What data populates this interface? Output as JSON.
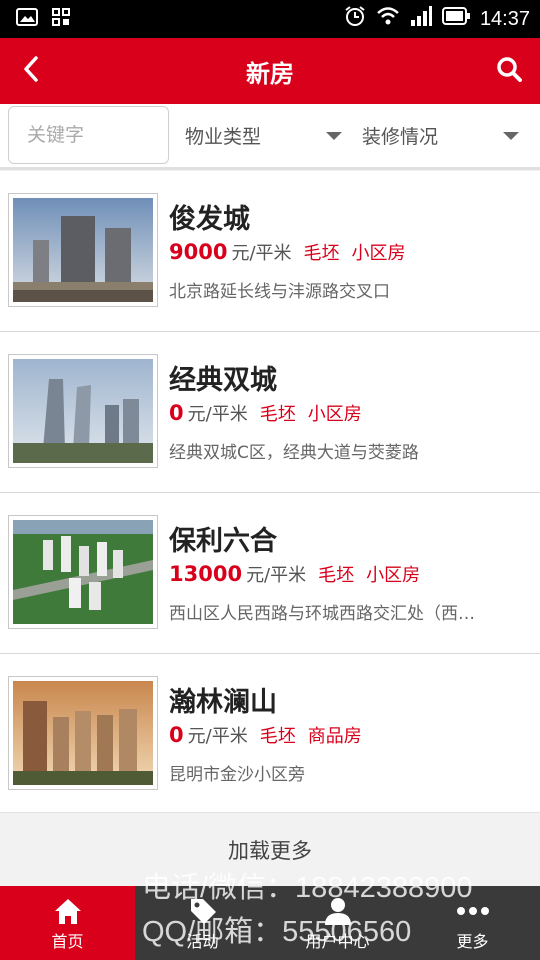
{
  "status_bar": {
    "time": "14:37",
    "icons": [
      "image-icon",
      "grid-icon",
      "alarm-icon",
      "wifi-icon",
      "signal-icon",
      "battery-icon"
    ]
  },
  "nav": {
    "title": "新房",
    "back_icon": "chevron-left-icon",
    "search_icon": "search-icon"
  },
  "filters": {
    "keyword_placeholder": "关键字",
    "property_type": "物业类型",
    "decoration": "装修情况"
  },
  "listings": [
    {
      "name": "俊发城",
      "price": "9000",
      "unit": "元/平米",
      "decoration": "毛坯",
      "type": "小区房",
      "address": "北京路延长线与沣源路交叉口"
    },
    {
      "name": "经典双城",
      "price": "0",
      "unit": "元/平米",
      "decoration": "毛坯",
      "type": "小区房",
      "address": "经典双城C区，经典大道与茭菱路"
    },
    {
      "name": "保利六合",
      "price": "13000",
      "unit": "元/平米",
      "decoration": "毛坯",
      "type": "小区房",
      "address": "西山区人民西路与环城西路交汇处（西…"
    },
    {
      "name": "瀚林澜山",
      "price": "0",
      "unit": "元/平米",
      "decoration": "毛坯",
      "type": "商品房",
      "address": "昆明市金沙小区旁"
    }
  ],
  "load_more": "加载更多",
  "tabs": [
    {
      "label": "首页",
      "icon": "home-icon",
      "active": true
    },
    {
      "label": "活动",
      "icon": "tag-icon",
      "active": false
    },
    {
      "label": "用户中心",
      "icon": "user-icon",
      "active": false
    },
    {
      "label": "更多",
      "icon": "more-icon",
      "active": false
    }
  ],
  "watermark": {
    "line1": "电话/微信：18842388900",
    "line2": "QQ/邮箱：55506560"
  },
  "colors": {
    "brand": "#d9001b",
    "tab_bar": "#3a3a3a"
  }
}
